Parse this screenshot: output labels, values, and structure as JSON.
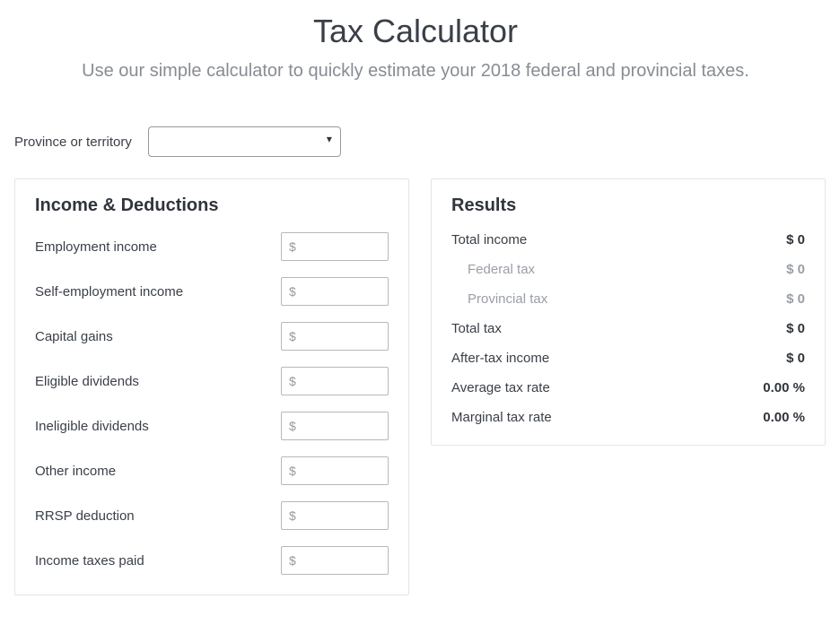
{
  "header": {
    "title": "Tax Calculator",
    "subtitle": "Use our simple calculator to quickly estimate your 2018 federal and provincial taxes."
  },
  "province": {
    "label": "Province or territory",
    "selected": ""
  },
  "income": {
    "heading": "Income & Deductions",
    "placeholder": "$",
    "fields": {
      "employment": {
        "label": "Employment income",
        "value": ""
      },
      "self_employment": {
        "label": "Self-employment income",
        "value": ""
      },
      "capital_gains": {
        "label": "Capital gains",
        "value": ""
      },
      "eligible_dividends": {
        "label": "Eligible dividends",
        "value": ""
      },
      "ineligible_dividends": {
        "label": "Ineligible dividends",
        "value": ""
      },
      "other_income": {
        "label": "Other income",
        "value": ""
      },
      "rrsp": {
        "label": "RRSP deduction",
        "value": ""
      },
      "taxes_paid": {
        "label": "Income taxes paid",
        "value": ""
      }
    }
  },
  "results": {
    "heading": "Results",
    "rows": {
      "total_income": {
        "label": "Total income",
        "value": "$ 0"
      },
      "federal_tax": {
        "label": "Federal tax",
        "value": "$ 0"
      },
      "provincial_tax": {
        "label": "Provincial tax",
        "value": "$ 0"
      },
      "total_tax": {
        "label": "Total tax",
        "value": "$ 0"
      },
      "after_tax": {
        "label": "After-tax income",
        "value": "$ 0"
      },
      "avg_rate": {
        "label": "Average tax rate",
        "value": "0.00 %"
      },
      "marginal_rate": {
        "label": "Marginal tax rate",
        "value": "0.00 %"
      }
    }
  }
}
